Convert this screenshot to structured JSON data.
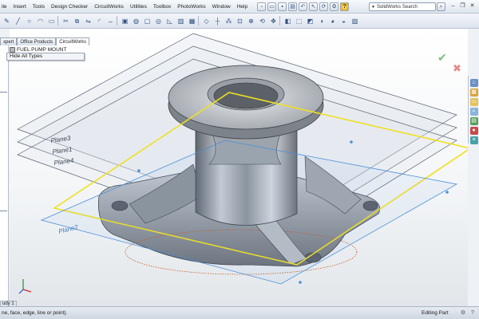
{
  "menu": {
    "items": [
      "ile",
      "Insert",
      "Tools",
      "Design Checker",
      "CircuitWorks",
      "Utilities",
      "Toolbox",
      "PhotoWorks",
      "Window",
      "Help"
    ],
    "search_placeholder": "SolidWorks Search"
  },
  "tabs": [
    "xpert",
    "Office Products",
    "CircuitWorks"
  ],
  "tree": {
    "root_label": "FUEL PUMP MOUNT",
    "dropdown_item": "Hide All Types"
  },
  "viewport": {
    "planes": [
      "Plane3",
      "Plane1",
      "Plane4",
      "Plane2"
    ]
  },
  "bottom_tab": "udy 1",
  "status": {
    "left_text": "ne, face, edge, line or point).",
    "right_text": "Editing Part"
  },
  "colors": {
    "selected_plane": "#f0e020",
    "preselect_plane": "#4a8fd8",
    "part": "#9ea4ab"
  },
  "icons": {
    "ok": "check-icon",
    "cancel": "close-icon",
    "help": "help-icon"
  }
}
